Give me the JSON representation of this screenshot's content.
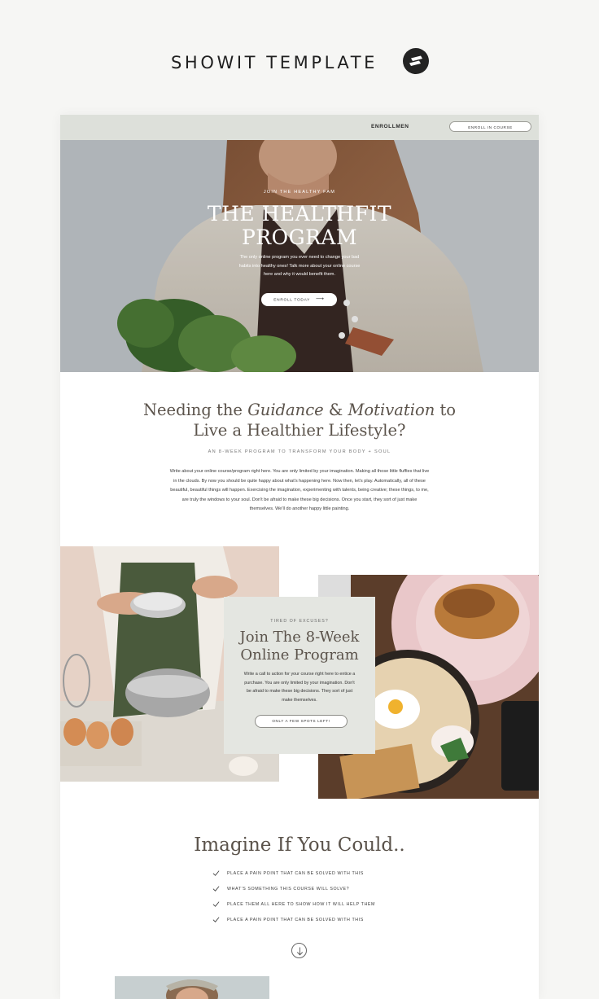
{
  "brand": {
    "title": "SHOWIT TEMPLATE",
    "logo_icon": "showit-logo-icon"
  },
  "nav": {
    "link": "ENROLLMEN",
    "button": "ENROLL IN COURSE"
  },
  "hero": {
    "eyebrow": "JOIN THE HEALTHY FAM",
    "title_line1": "THE HEALTHFIT",
    "title_line2": "PROGRAM",
    "description": "The only online program you ever need to change your bad habits into healthy ones! Talk more about your online course here and why it would benefit them.",
    "button": "ENROLL TODAY",
    "button_icon": "arrow-right-icon"
  },
  "intro": {
    "title_part1": "Needing the ",
    "title_em1": "Guidance",
    "title_part2": " & ",
    "title_em2": "Motivation",
    "title_part3": " to",
    "title_line2": "Live a Healthier Lifestyle?",
    "subtitle": "AN 8-WEEK PROGRAM TO TRANSFORM YOUR BODY + SOUL",
    "body": "Write about your online course/program right here. You are only limited by your imagination. Making all those little fluffies that live in the clouds. By now you should be quite happy about what's happening here. Now then, let's play. Automatically, all of these beautiful, beautiful things will happen. Exercising the imagination, experimenting with talents, being creative; these things, to me, are truly the windows to your soul. Don't be afraid to make these big decisions. Once you start, they sort of just make themselves. We'll do another happy little painting."
  },
  "cta": {
    "eyebrow": "TIRED OF EXCUSES?",
    "title_line1": "Join The 8-Week",
    "title_line2": "Online Program",
    "body": "Write a call to action for your course right here to entice a purchase. You are only limited by your imagination. Don't be afraid to make these big decisions. They sort of just make themselves.",
    "button": "ONLY A FEW SPOTS LEFT!"
  },
  "imagine": {
    "title": "Imagine If You Could..",
    "items": [
      "PLACE A PAIN POINT THAT CAN BE SOLVED WITH THIS",
      "WHAT'S SOMETHING THIS COURSE WILL SOLVE?",
      "PLACE THEM ALL HERE TO SHOW HOW IT WILL HELP THEM",
      "PLACE A PAIN POINT THAT CAN BE SOLVED WITH THIS"
    ],
    "item_icon": "checkmark-icon",
    "scroll_icon": "arrow-down-circle-icon"
  },
  "colors": {
    "page_bg": "#f6f6f4",
    "nav_bg": "#dde0da",
    "cta_card_bg": "#e4e6e1",
    "heading_brown": "#5b534b",
    "brand_dark": "#232323"
  }
}
